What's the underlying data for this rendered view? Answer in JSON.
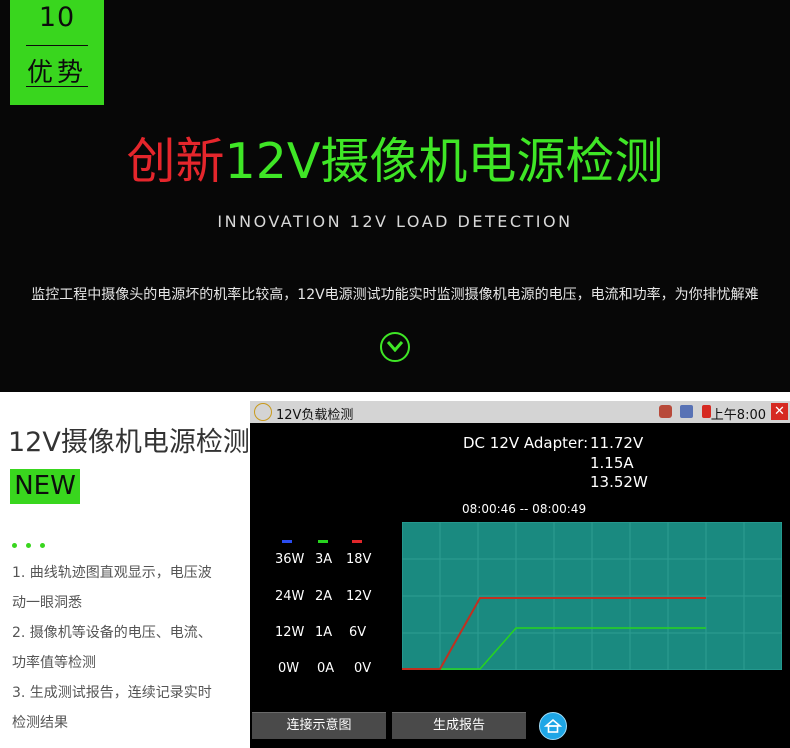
{
  "badge": {
    "number": "10",
    "word": "优势"
  },
  "headline": {
    "red": "创新",
    "green": "12V摄像机电源检测"
  },
  "subhead": "INNOVATION 12V LOAD DETECTION",
  "description": "监控工程中摄像头的电源坏的机率比较高，12V电源测试功能实时监测摄像机电源的电压，电流和功率，为你排忧解难",
  "left_panel": {
    "title": "12V摄像机电源检测",
    "new_label": "NEW",
    "features": [
      "1. 曲线轨迹图直观显示，电压波",
      "动一眼洞悉",
      "2. 摄像机等设备的电压、电流、",
      "功率值等检测",
      "3. 生成测试报告，连续记录实时",
      "检测结果"
    ]
  },
  "device": {
    "window_title": "12V负载检测",
    "clock": "上午8:00",
    "close_label": "✕",
    "adapter_label": "DC 12V Adapter:",
    "voltage": "11.72V",
    "current": "1.15A",
    "power": "13.52W",
    "time_range": "08:00:46 -- 08:00:49",
    "legend_colors": {
      "power": "#2a4cf0",
      "current": "#27d41f",
      "voltage": "#e0262a"
    },
    "axis_labels": {
      "power": [
        "36W",
        "24W",
        "12W",
        "0W"
      ],
      "current": [
        "3A",
        "2A",
        "1A",
        "0A"
      ],
      "voltage": [
        "18V",
        "12V",
        "6V",
        "0V"
      ]
    },
    "buttons": {
      "connect": "连接示意图",
      "report": "生成报告"
    },
    "icons": {
      "app": "gauge-icon",
      "home": "home-icon"
    }
  },
  "colors": {
    "accent_green": "#39d61e",
    "headline_red": "#e5262c",
    "chart_bg": "#1a8a80",
    "chart_grid": "#2d9d92"
  }
}
